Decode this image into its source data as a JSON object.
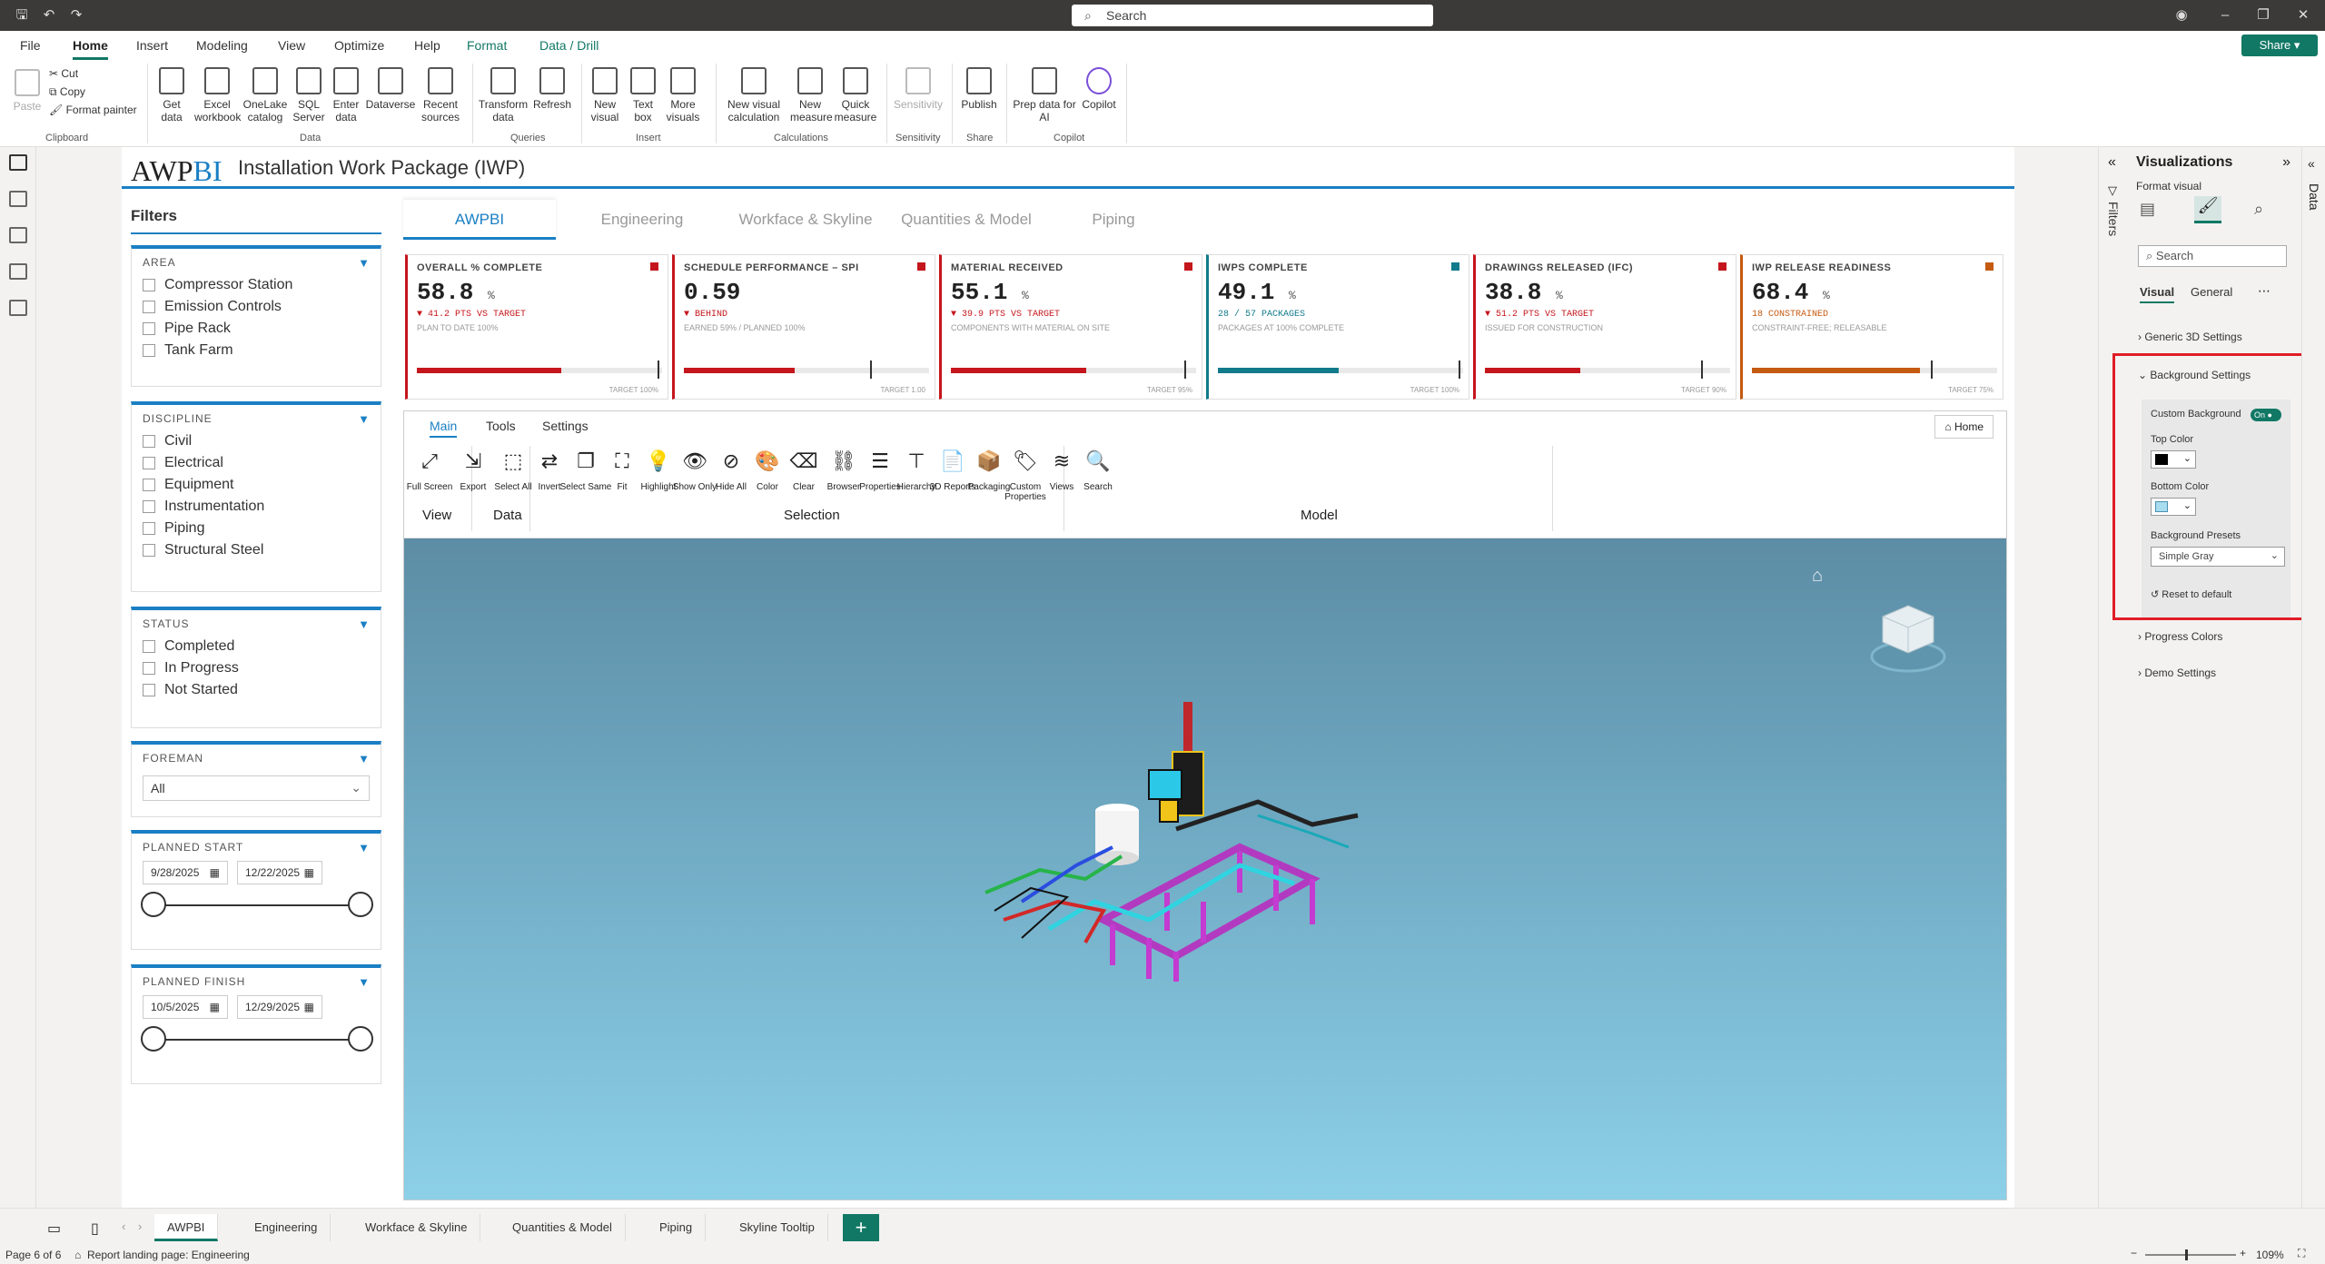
{
  "titlebar": {
    "search_placeholder": "Search"
  },
  "menu": [
    "File",
    "Home",
    "Insert",
    "Modeling",
    "View",
    "Optimize",
    "Help",
    "Format",
    "Data / Drill"
  ],
  "share_label": "Share",
  "ribbon": {
    "clipboard": {
      "paste": "Paste",
      "cut": "Cut",
      "copy": "Copy",
      "format_painter": "Format painter",
      "group": "Clipboard"
    },
    "data": {
      "items": [
        "Get data",
        "Excel workbook",
        "OneLake catalog",
        "SQL Server",
        "Enter data",
        "Dataverse",
        "Recent sources"
      ],
      "group": "Data"
    },
    "queries": {
      "items": [
        "Transform data",
        "Refresh"
      ],
      "group": "Queries"
    },
    "insert": {
      "items": [
        "New visual",
        "Text box",
        "More visuals"
      ],
      "group": "Insert"
    },
    "calculations": {
      "items": [
        "New visual calculation",
        "New measure",
        "Quick measure"
      ],
      "group": "Calculations"
    },
    "sensitivity": {
      "items": [
        "Sensitivity"
      ],
      "group": "Sensitivity"
    },
    "share": {
      "items": [
        "Publish"
      ],
      "group": "Share"
    },
    "copilot": {
      "items": [
        "Prep data for AI",
        "Copilot"
      ],
      "group": "Copilot"
    }
  },
  "report": {
    "logo_a": "AWP",
    "logo_b": "BI",
    "title": "Installation Work Package (IWP)"
  },
  "filters": {
    "title": "Filters",
    "area": {
      "label": "AREA",
      "items": [
        "Compressor Station",
        "Emission Controls",
        "Pipe Rack",
        "Tank Farm"
      ]
    },
    "discipline": {
      "label": "DISCIPLINE",
      "items": [
        "Civil",
        "Electrical",
        "Equipment",
        "Instrumentation",
        "Piping",
        "Structural Steel"
      ]
    },
    "status": {
      "label": "STATUS",
      "items": [
        "Completed",
        "In Progress",
        "Not Started"
      ]
    },
    "foreman": {
      "label": "FOREMAN",
      "value": "All"
    },
    "planned_start": {
      "label": "PLANNED START",
      "from": "9/28/2025",
      "to": "12/22/2025"
    },
    "planned_finish": {
      "label": "PLANNED FINISH",
      "from": "10/5/2025",
      "to": "12/29/2025"
    }
  },
  "tabs": [
    "AWPBI",
    "Engineering",
    "Workface & Skyline",
    "Quantities & Model",
    "Piping"
  ],
  "kpis": [
    {
      "title": "OVERALL % COMPLETE",
      "value": "58.8",
      "unit": "%",
      "status": "▼ 41.2 PTS VS TARGET",
      "note": "PLAN TO DATE 100%",
      "target_label": "TARGET 100%",
      "fill": 0.588,
      "target": 0.98,
      "color": "#c4161c"
    },
    {
      "title": "SCHEDULE PERFORMANCE – SPI",
      "value": "0.59",
      "unit": "",
      "status": "▼ BEHIND",
      "note": "EARNED 59% / PLANNED 100%",
      "target_label": "TARGET 1.00",
      "fill": 0.45,
      "target": 0.76,
      "color": "#c4161c"
    },
    {
      "title": "MATERIAL RECEIVED",
      "value": "55.1",
      "unit": "%",
      "status": "▼ 39.9 PTS VS TARGET",
      "note": "COMPONENTS WITH MATERIAL ON SITE",
      "target_label": "TARGET 95%",
      "fill": 0.551,
      "target": 0.95,
      "color": "#c4161c"
    },
    {
      "title": "IWPS COMPLETE",
      "value": "49.1",
      "unit": "%",
      "status": "28 / 57 PACKAGES",
      "note": "PACKAGES AT 100% COMPLETE",
      "target_label": "TARGET 100%",
      "fill": 0.491,
      "target": 0.98,
      "color": "#117a8b"
    },
    {
      "title": "DRAWINGS RELEASED (IFC)",
      "value": "38.8",
      "unit": "%",
      "status": "▼ 51.2 PTS VS TARGET",
      "note": "ISSUED FOR CONSTRUCTION",
      "target_label": "TARGET 90%",
      "fill": 0.388,
      "target": 0.88,
      "color": "#c4161c"
    },
    {
      "title": "IWP RELEASE READINESS",
      "value": "68.4",
      "unit": "%",
      "status": "18 CONSTRAINED",
      "note": "CONSTRAINT-FREE; RELEASABLE",
      "target_label": "TARGET 75%",
      "fill": 0.684,
      "target": 0.73,
      "color": "#c55a11"
    }
  ],
  "viewer": {
    "tabs": [
      "Main",
      "Tools",
      "Settings"
    ],
    "home_label": "Home",
    "tools": [
      {
        "label": "Full Screen",
        "glyph": "⤢"
      },
      {
        "label": "Export",
        "glyph": "⇲"
      },
      {
        "label": "Select All",
        "glyph": "⬚"
      },
      {
        "label": "Invert",
        "glyph": "⇄"
      },
      {
        "label": "Select Same",
        "glyph": "❐"
      },
      {
        "label": "Fit",
        "glyph": "⛶"
      },
      {
        "label": "Highlight",
        "glyph": "💡"
      },
      {
        "label": "Show Only",
        "glyph": "👁"
      },
      {
        "label": "Hide All",
        "glyph": "⊘"
      },
      {
        "label": "Color",
        "glyph": "🎨"
      },
      {
        "label": "Clear",
        "glyph": "⌫"
      },
      {
        "label": "Browser",
        "glyph": "⛓"
      },
      {
        "label": "Properties",
        "glyph": "☰"
      },
      {
        "label": "Hierarchy",
        "glyph": "⊤"
      },
      {
        "label": "3D Reports",
        "glyph": "📄"
      },
      {
        "label": "Packaging",
        "glyph": "📦"
      },
      {
        "label": "Custom Properties",
        "glyph": "🏷"
      },
      {
        "label": "Views",
        "glyph": "≋"
      },
      {
        "label": "Search",
        "glyph": "🔍"
      }
    ],
    "groups": [
      "View",
      "Data",
      "Selection",
      "Model"
    ]
  },
  "vispane": {
    "title": "Visualizations",
    "subtitle": "Format visual",
    "search": "Search",
    "tab_visual": "Visual",
    "tab_general": "General",
    "sections": [
      "Generic 3D Settings",
      "Background Settings",
      "Progress Colors",
      "Demo Settings"
    ],
    "custom_bg": "Custom Background",
    "toggle": "On",
    "top_color": "Top Color",
    "bottom_color": "Bottom Color",
    "presets_label": "Background Presets",
    "preset_value": "Simple Gray",
    "reset": "Reset to default",
    "top_color_hex": "#000000",
    "bottom_color_hex": "#a8dcef"
  },
  "side_labels": {
    "filters": "Filters",
    "data": "Data"
  },
  "pages": [
    "AWPBI",
    "Engineering",
    "Workface & Skyline",
    "Quantities & Model",
    "Piping",
    "Skyline Tooltip"
  ],
  "status": {
    "page": "Page 6 of 6",
    "landing": "Report landing page: Engineering",
    "zoom": "109%"
  }
}
